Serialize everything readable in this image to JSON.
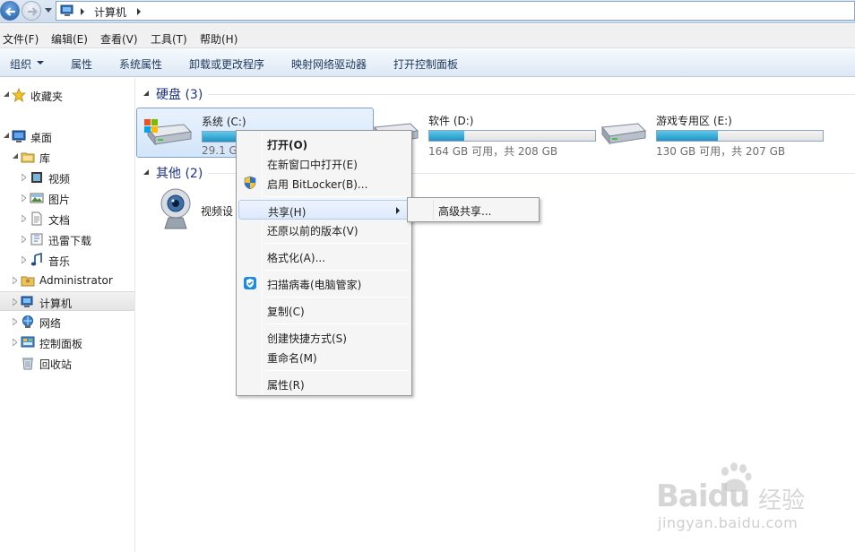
{
  "address": {
    "path": "计算机"
  },
  "menubar": [
    "文件(F)",
    "编辑(E)",
    "查看(V)",
    "工具(T)",
    "帮助(H)"
  ],
  "commandbar": {
    "organize": "组织",
    "items": [
      "属性",
      "系统属性",
      "卸载或更改程序",
      "映射网络驱动器",
      "打开控制面板"
    ]
  },
  "navpane": {
    "favorites": "收藏夹",
    "desktop": "桌面",
    "library": "库",
    "library_items": [
      "视频",
      "图片",
      "文档",
      "迅雷下载",
      "音乐"
    ],
    "administrator": "Administrator",
    "computer": "计算机",
    "network": "网络",
    "control_panel": "控制面板",
    "recycle_bin": "回收站"
  },
  "groups": {
    "harddisks": "硬盘 (3)",
    "others": "其他 (2)"
  },
  "drives": [
    {
      "name": "系统 (C:)",
      "free": "29.1 G",
      "used_fraction": 0.42
    },
    {
      "name": "软件 (D:)",
      "free": "164 GB 可用，共 208 GB",
      "used_fraction": 0.21
    },
    {
      "name": "游戏专用区 (E:)",
      "free": "130 GB 可用，共 207 GB",
      "used_fraction": 0.37
    }
  ],
  "device": {
    "label": "视频设"
  },
  "context_menu": {
    "open": "打开(O)",
    "open_new_window": "在新窗口中打开(E)",
    "bitlocker": "启用 BitLocker(B)...",
    "share": "共享(H)",
    "restore": "还原以前的版本(V)",
    "format": "格式化(A)...",
    "scan": "扫描病毒(电脑管家)",
    "copy": "复制(C)",
    "shortcut": "创建快捷方式(S)",
    "rename": "重命名(M)",
    "properties": "属性(R)"
  },
  "submenu": {
    "advanced_share": "高级共享..."
  },
  "watermark": {
    "brand": "Baidu",
    "cn": "经验",
    "url": "jingyan.baidu.com"
  }
}
